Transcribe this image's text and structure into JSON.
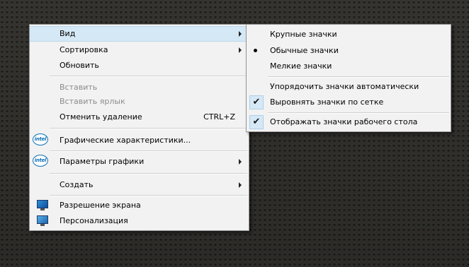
{
  "context_menu": {
    "view": "Вид",
    "sort": "Сортировка",
    "refresh": "Обновить",
    "paste": "Вставить",
    "paste_shortcut": "Вставить ярлык",
    "undo_delete": "Отменить удаление",
    "undo_delete_shortcut": "CTRL+Z",
    "graphics_properties": "Графические характеристики...",
    "graphics_options": "Параметры графики",
    "new": "Создать",
    "screen_resolution": "Разрешение экрана",
    "personalize": "Персонализация",
    "intel_logo": "intel"
  },
  "view_submenu": {
    "large_icons": "Крупные значки",
    "medium_icons": "Обычные значки",
    "small_icons": "Мелкие значки",
    "auto_arrange": "Упорядочить значки автоматически",
    "align_to_grid": "Выровнять значки по сетке",
    "show_desktop_icons": "Отображать значки рабочего стола",
    "selected_view": "Обычные значки",
    "check_glyph": "✔"
  }
}
